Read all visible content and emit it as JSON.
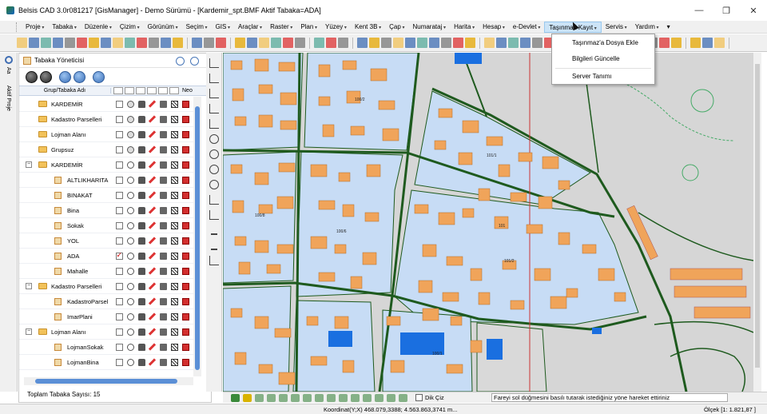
{
  "window": {
    "title": "Belsis CAD 3.0r081217 [GisManager] - Demo Sürümü - [Kardemir_spt.BMF  Aktif Tabaka=ADA]",
    "controls": {
      "minimize": "—",
      "maximize": "❐",
      "close": "✕"
    }
  },
  "menu": [
    {
      "label": "Proje",
      "name": "proje"
    },
    {
      "label": "Tabaka",
      "name": "tabaka"
    },
    {
      "label": "Düzenle",
      "name": "duzenle"
    },
    {
      "label": "Çizim",
      "name": "cizim"
    },
    {
      "label": "Görünüm",
      "name": "gorunum"
    },
    {
      "label": "Seçim",
      "name": "secim"
    },
    {
      "label": "GIS",
      "name": "gis"
    },
    {
      "label": "Araçlar",
      "name": "araclar"
    },
    {
      "label": "Raster",
      "name": "raster"
    },
    {
      "label": "Plan",
      "name": "plan"
    },
    {
      "label": "Yüzey",
      "name": "yuzey"
    },
    {
      "label": "Kent 3B",
      "name": "kent3b"
    },
    {
      "label": "Çap",
      "name": "cap"
    },
    {
      "label": "Numarataj",
      "name": "numarataj"
    },
    {
      "label": "Harita",
      "name": "harita"
    },
    {
      "label": "Hesap",
      "name": "hesap"
    },
    {
      "label": "e-Devlet",
      "name": "edevlet"
    },
    {
      "label": "Taşınmaz Kayıt",
      "name": "tasinmaz-kayit",
      "active": true
    },
    {
      "label": "Servis",
      "name": "servis"
    },
    {
      "label": "Yardım",
      "name": "yardim"
    }
  ],
  "dropdown": {
    "items": [
      "Taşınmaz'a Dosya Ekle",
      "Bilgileri Güncelle",
      "Server Tanımı"
    ]
  },
  "left_strip": {
    "aa": "Aa",
    "aktif_proje": "Aktif Proje"
  },
  "layer_panel": {
    "title": "Tabaka Yöneticisi",
    "column_name": "Grup/Tabaka Adı",
    "column_neo": "Neo",
    "footer": "Toplam Tabaka Sayısı: 15",
    "rows": [
      {
        "label": "KARDEMİR",
        "type": "group",
        "level": 0,
        "expander": ""
      },
      {
        "label": "Kadastro Parselleri",
        "type": "group",
        "level": 0,
        "expander": ""
      },
      {
        "label": "Lojman Alanı",
        "type": "group",
        "level": 0,
        "expander": ""
      },
      {
        "label": "Grupsuz",
        "type": "group",
        "level": 0,
        "expander": ""
      },
      {
        "label": "KARDEMİR",
        "type": "group",
        "level": 0,
        "expander": "−"
      },
      {
        "label": "ALTLIKHARITA",
        "type": "layer",
        "level": 1
      },
      {
        "label": "BINAKAT",
        "type": "layer",
        "level": 1
      },
      {
        "label": "Bina",
        "type": "layer",
        "level": 1
      },
      {
        "label": "Sokak",
        "type": "layer",
        "level": 1
      },
      {
        "label": "YOL",
        "type": "layer",
        "level": 1
      },
      {
        "label": "ADA",
        "type": "layer",
        "level": 1,
        "active": true
      },
      {
        "label": "Mahalle",
        "type": "layer",
        "level": 1
      },
      {
        "label": "Kadastro Parselleri",
        "type": "group",
        "level": 0,
        "expander": "−"
      },
      {
        "label": "KadastroParsel",
        "type": "layer",
        "level": 1
      },
      {
        "label": "ImarPlani",
        "type": "layer",
        "level": 1
      },
      {
        "label": "Lojman Alanı",
        "type": "group",
        "level": 0,
        "expander": "−"
      },
      {
        "label": "LojmanSokak",
        "type": "layer",
        "level": 1
      },
      {
        "label": "LojmanBina",
        "type": "layer",
        "level": 1
      }
    ]
  },
  "map": {
    "parcel_labels": [
      "100/2",
      "101/1",
      "100/6",
      "101",
      "101/2",
      "100/8",
      "100/1"
    ],
    "colors": {
      "block": "#c7dcf5",
      "building": "#f0a45a",
      "road": "#1e5a1e",
      "background": "#d6d6d6",
      "water": "#1a6fe0"
    }
  },
  "bottom": {
    "dik_ciz": "Dik Çiz",
    "message": "Fareyi sol düğmesini basılı tutarak istediğiniz yöne hareket ettiriniz"
  },
  "status": {
    "coord": "Koordinat(Y;X)  468.079,3388; 4.563.863,3741 m...",
    "scale": "Ölçek [1: 1.821,87 ]"
  }
}
